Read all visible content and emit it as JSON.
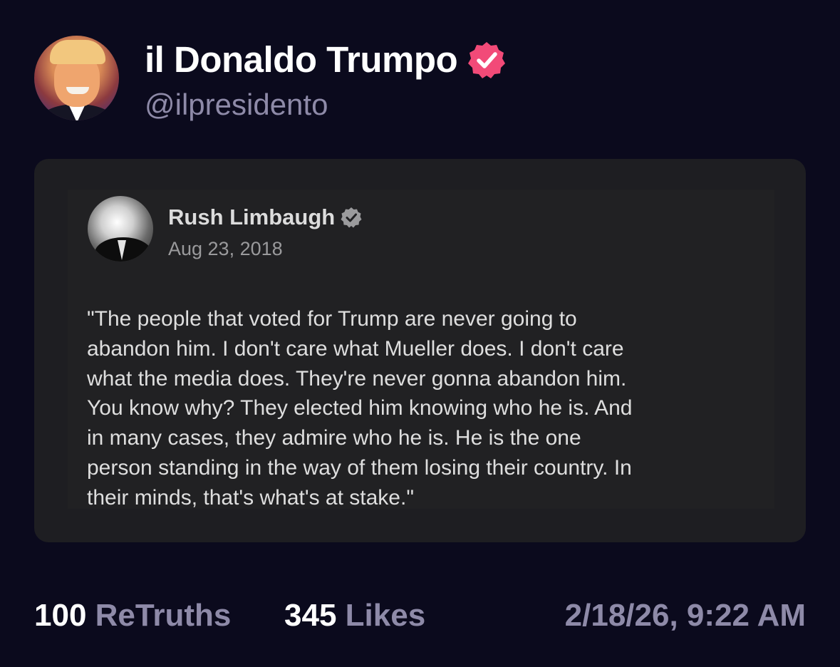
{
  "post": {
    "author": {
      "display_name": "il Donaldo Trumpo",
      "handle": "@ilpresidento",
      "verified_icon": "verified-badge-icon",
      "verified_color": "#f24a78"
    },
    "quoted": {
      "author_name": "Rush Limbaugh",
      "date": "Aug 23, 2018",
      "verified_icon": "verified-check-icon",
      "text": "\"The people that voted for Trump are never going to\nabandon him.  I don't care what Mueller does.  I don't care\nwhat the media does.  They're never gonna abandon him.\nYou know why?  They elected him knowing who he is.  And\nin many cases, they admire who he is.  He is the one\nperson standing in the way of them losing their country.  In\ntheir minds, that's what's at stake.\""
    },
    "stats": {
      "retruths_count": "100",
      "retruths_label": "ReTruths",
      "likes_count": "345",
      "likes_label": "Likes",
      "timestamp": "2/18/26, 9:22 AM"
    }
  },
  "colors": {
    "background": "#0b0a1d",
    "card": "#1e1e22",
    "muted_text": "#8e8aa8"
  }
}
